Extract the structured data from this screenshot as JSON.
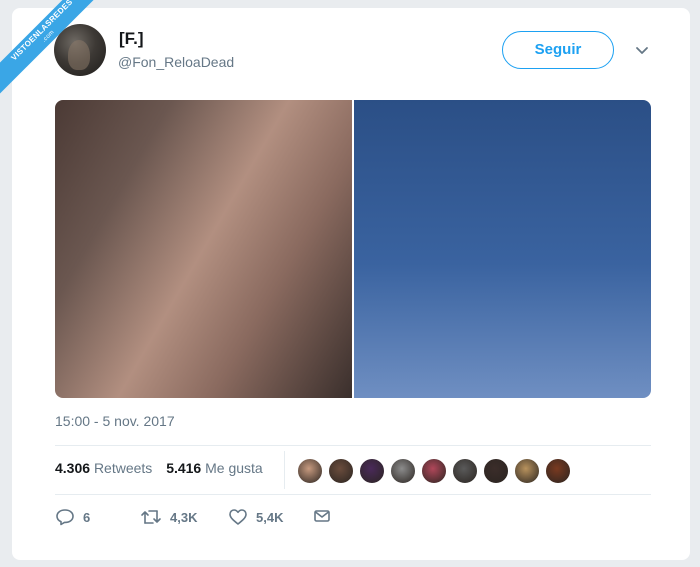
{
  "watermark": {
    "text": "VISTOENLASREDES",
    "sub": ".com"
  },
  "tweet": {
    "display_name": "[F.]",
    "handle": "@Fon_ReloaDead",
    "follow_label": "Seguir",
    "timestamp": "15:00 - 5 nov. 2017",
    "retweets_count": "4.306",
    "retweets_label": "Retweets",
    "likes_count": "5.416",
    "likes_label": "Me gusta"
  },
  "actions": {
    "reply_count": "6",
    "retweet_count": "4,3K",
    "like_count": "5,4K"
  },
  "icons": {
    "more": "chevron-down-icon",
    "reply": "reply-icon",
    "retweet": "retweet-icon",
    "like": "heart-icon",
    "dm": "mail-icon"
  },
  "colors": {
    "accent": "#1da1f2",
    "muted": "#657786",
    "text": "#14171a",
    "ribbon": "#3aa6e6"
  },
  "likers": [
    "#c79a7f",
    "#6b4d3d",
    "#4a2a5a",
    "#8c8c8c",
    "#b0475a",
    "#5a5a5a",
    "#3b2d2a",
    "#b8925d",
    "#7a3a20"
  ]
}
